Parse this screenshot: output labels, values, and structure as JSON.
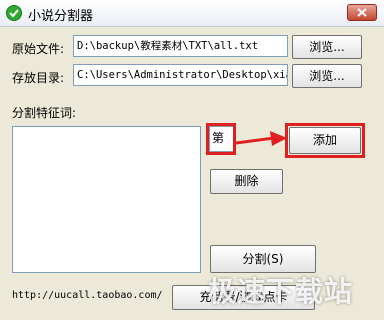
{
  "window": {
    "title": "小说分割器"
  },
  "source_file": {
    "label": "原始文件:",
    "value": "D:\\backup\\教程素材\\TXT\\all.txt",
    "browse_label": "浏览..."
  },
  "output_dir": {
    "label": "存放目录:",
    "value": "C:\\Users\\Administrator\\Desktop\\xiao",
    "browse_label": "浏览..."
  },
  "split_words": {
    "label": "分割特征词:",
    "input_value": "第",
    "add_label": "添加",
    "delete_label": "删除",
    "split_label": "分割(S)"
  },
  "footer": {
    "url": "http://uucall.taobao.com/",
    "recharge_label": "充话费/游戏点卡"
  },
  "watermark": {
    "text": "极速下载站"
  },
  "colors": {
    "highlight": "#e02020",
    "titlebar": "#e9eef4"
  }
}
